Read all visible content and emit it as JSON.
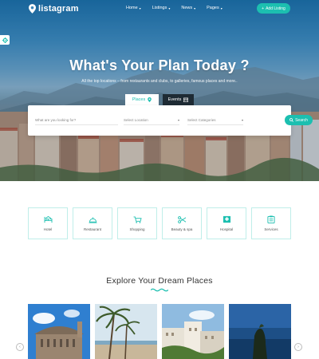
{
  "brand": {
    "name": "listagram"
  },
  "nav": {
    "items": [
      {
        "label": "Home"
      },
      {
        "label": "Listings"
      },
      {
        "label": "News"
      },
      {
        "label": "Pages"
      }
    ],
    "add_listing_label": "Add Listing"
  },
  "hero": {
    "title": "What's Your Plan Today ?",
    "subtitle": "All the top locations – from restaurants and clubs, to galleries, famous places and more.."
  },
  "search": {
    "tabs": [
      {
        "label": "Places",
        "icon": "map-pin-icon",
        "active": true
      },
      {
        "label": "Events",
        "icon": "calendar-icon",
        "active": false
      }
    ],
    "keyword_placeholder": "What are you looking for?",
    "location_placeholder": "Select Location",
    "category_placeholder": "Select Categories",
    "button_label": "Search"
  },
  "categories": [
    {
      "label": "Hotel",
      "icon": "bed-icon"
    },
    {
      "label": "Restaurant",
      "icon": "cloche-icon"
    },
    {
      "label": "Shopping",
      "icon": "cart-icon"
    },
    {
      "label": "Beauty & spa",
      "icon": "scissors-icon"
    },
    {
      "label": "Hospital",
      "icon": "hospital-icon"
    },
    {
      "label": "Services",
      "icon": "clipboard-icon"
    }
  ],
  "section": {
    "title": "Explore Your Dream Places"
  },
  "colors": {
    "accent": "#1cbfb0",
    "dark_tab": "#1e2b34",
    "text": "#333333"
  }
}
